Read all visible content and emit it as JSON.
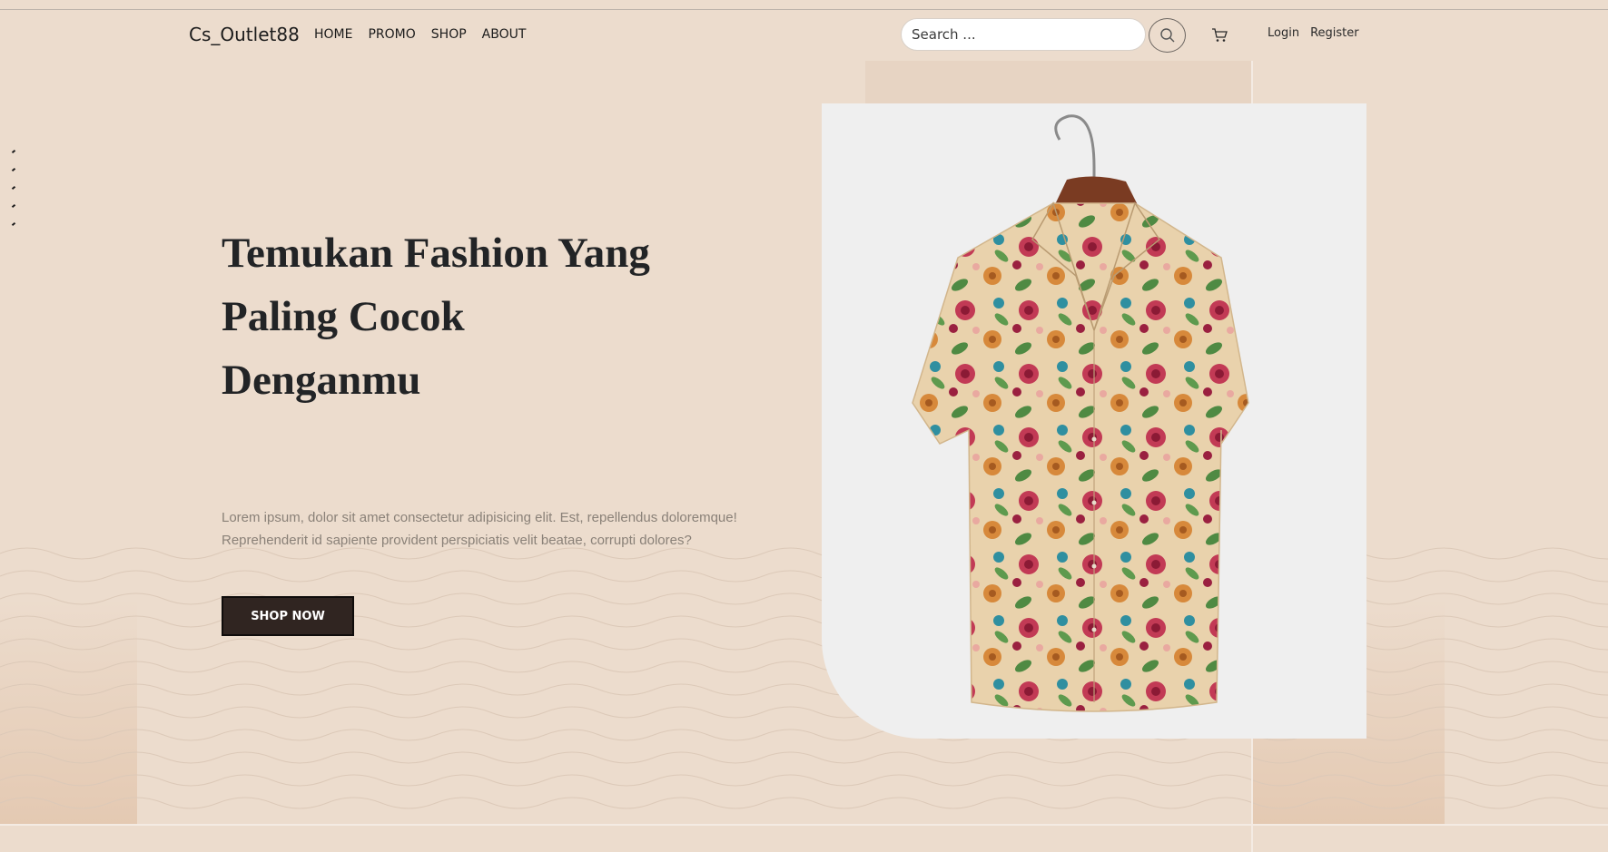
{
  "brand": "Cs_Outlet88",
  "nav": {
    "home": "HOME",
    "promo": "PROMO",
    "shop": "SHOP",
    "about": "ABOUT"
  },
  "search": {
    "placeholder": "Search ..."
  },
  "icons": {
    "search": "search-icon",
    "cart": "cart-icon"
  },
  "auth": {
    "login": "Login",
    "register": "Register"
  },
  "hero": {
    "title_line1": "Temukan Fashion Yang",
    "title_line2": "Paling Cocok",
    "title_line3": "Denganmu",
    "description_line1": "Lorem ipsum, dolor sit amet consectetur adipisicing elit. Est, repellendus doloremque!",
    "description_line2": "Reprehenderit id sapiente provident perspiciatis velit beatae, corrupti dolores?",
    "cta": "SHOP NOW"
  },
  "colors": {
    "background": "#ecdccd",
    "button": "#302521",
    "card": "#efefef",
    "text": "#222426"
  }
}
